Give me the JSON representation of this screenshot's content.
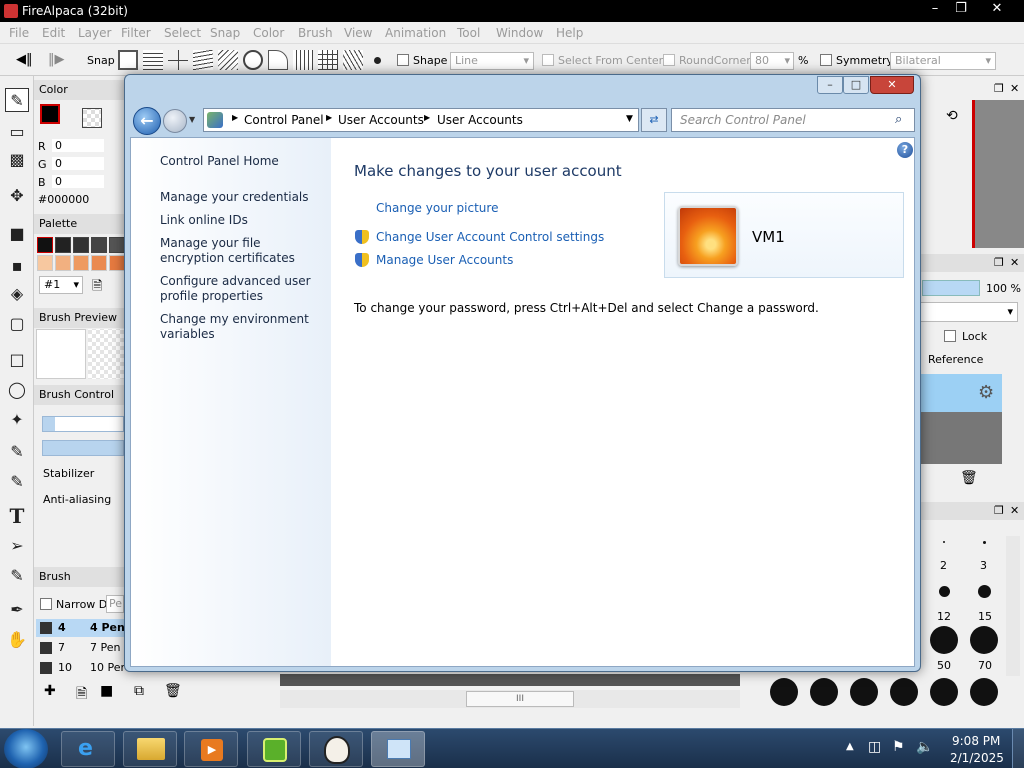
{
  "firealpaca": {
    "title": "FireAlpaca (32bit)",
    "menu": [
      "File",
      "Edit",
      "Layer",
      "Filter",
      "Select",
      "Snap",
      "Color",
      "Brush",
      "View",
      "Animation",
      "Tool",
      "Window",
      "Help"
    ],
    "toolbar": {
      "snap_label": "Snap",
      "shape_label": "Shape",
      "shape_value": "Line",
      "select_from_center": "Select From Center",
      "round_corner": "RoundCorner",
      "round_corner_value": "80",
      "percent": "%",
      "symmetry_label": "Symmetry",
      "symmetry_value": "Bilateral"
    },
    "color_panel": {
      "title": "Color",
      "r_label": "R",
      "r": "0",
      "g_label": "G",
      "g": "0",
      "b_label": "B",
      "b": "0",
      "hex": "#000000"
    },
    "palette": {
      "title": "Palette",
      "selector": "#1"
    },
    "brush_preview_title": "Brush Preview",
    "brush_control": {
      "title": "Brush Control",
      "stabilizer": "Stabilizer",
      "antialiasing": "Anti-aliasing"
    },
    "brush_panel": {
      "title": "Brush",
      "narrow": "Narrow D",
      "search": "Pe",
      "rows": [
        {
          "size": "4",
          "name": "4 Pen"
        },
        {
          "size": "7",
          "name": "7 Pen"
        },
        {
          "size": "10",
          "name": "10 Pen"
        }
      ]
    },
    "layer_panel": {
      "opacity": "100 %",
      "lock": "Lock",
      "reference": "Reference"
    },
    "brush_sizes": [
      "2",
      "3",
      "12",
      "15",
      "50",
      "70"
    ],
    "scroll_grip": "III"
  },
  "control_panel": {
    "breadcrumb": [
      "Control Panel",
      "User Accounts",
      "User Accounts"
    ],
    "search_placeholder": "Search Control Panel",
    "nav": {
      "home": "Control Panel Home",
      "items": [
        "Manage your credentials",
        "Link online IDs",
        "Manage your file encryption certificates",
        "Configure advanced user profile properties",
        "Change my environment variables"
      ]
    },
    "heading": "Make changes to your user account",
    "links": {
      "change_picture": "Change your picture",
      "uac": "Change User Account Control settings",
      "manage": "Manage User Accounts"
    },
    "user_name": "VM1",
    "password_note": "To change your password, press Ctrl+Alt+Del and select Change a password."
  },
  "taskbar": {
    "time": "9:08 PM",
    "date": "2/1/2025"
  }
}
